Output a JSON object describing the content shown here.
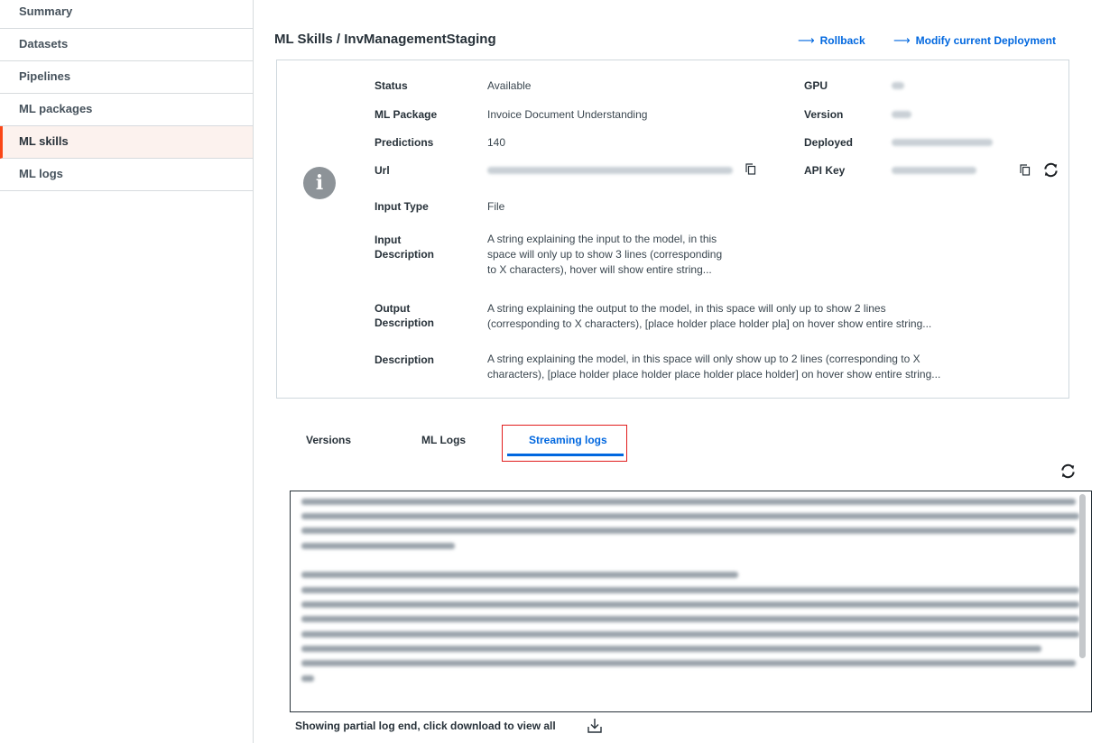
{
  "sidebar": {
    "items": [
      {
        "label": "Summary"
      },
      {
        "label": "Datasets"
      },
      {
        "label": "Pipelines"
      },
      {
        "label": "ML packages"
      },
      {
        "label": "ML skills",
        "active": true
      },
      {
        "label": "ML logs"
      }
    ]
  },
  "header": {
    "breadcrumb": "ML Skills / InvManagementStaging",
    "rollback_label": "Rollback",
    "modify_label": "Modify current Deployment"
  },
  "details": {
    "status_label": "Status",
    "status_value": "Available",
    "package_label": "ML Package",
    "package_value": "Invoice Document Understanding",
    "predictions_label": "Predictions",
    "predictions_value": "140",
    "url_label": "Url",
    "input_type_label": "Input Type",
    "input_type_value": "File",
    "input_desc_label_1": "Input",
    "input_desc_label_2": "Description",
    "input_desc_line_1": "A string explaining the input to the model, in this",
    "input_desc_line_2": "space will only up to show 3 lines (corresponding",
    "input_desc_line_3": "to X characters), hover will show entire string...",
    "output_desc_label_1": "Output",
    "output_desc_label_2": "Description",
    "output_desc_line_1": "A string explaining the output to the model, in this space will only up to  show 2 lines",
    "output_desc_line_2": "(corresponding to X characters), [place holder place holder pla] on hover show entire string...",
    "description_label": "Description",
    "description_line_1": "A string explaining the model, in this space will only show up to 2 lines (corresponding to X",
    "description_line_2": "characters), [place holder place holder place holder place holder] on hover show entire string...",
    "gpu_label": "GPU",
    "version_label": "Version",
    "deployed_label": "Deployed",
    "api_key_label": "API Key"
  },
  "tabs": [
    {
      "label": "Versions"
    },
    {
      "label": "ML Logs"
    },
    {
      "label": "Streaming logs",
      "active": true
    }
  ],
  "logs": {
    "footer_note": "Showing partial log end, click download to view all"
  },
  "colors": {
    "accent": "#0067df",
    "active_marker": "#fa4616",
    "highlight_border": "#e11d1d"
  },
  "icons": [
    "info-icon",
    "copy-icon",
    "refresh-icon",
    "download-icon",
    "arrow-right-icon"
  ]
}
